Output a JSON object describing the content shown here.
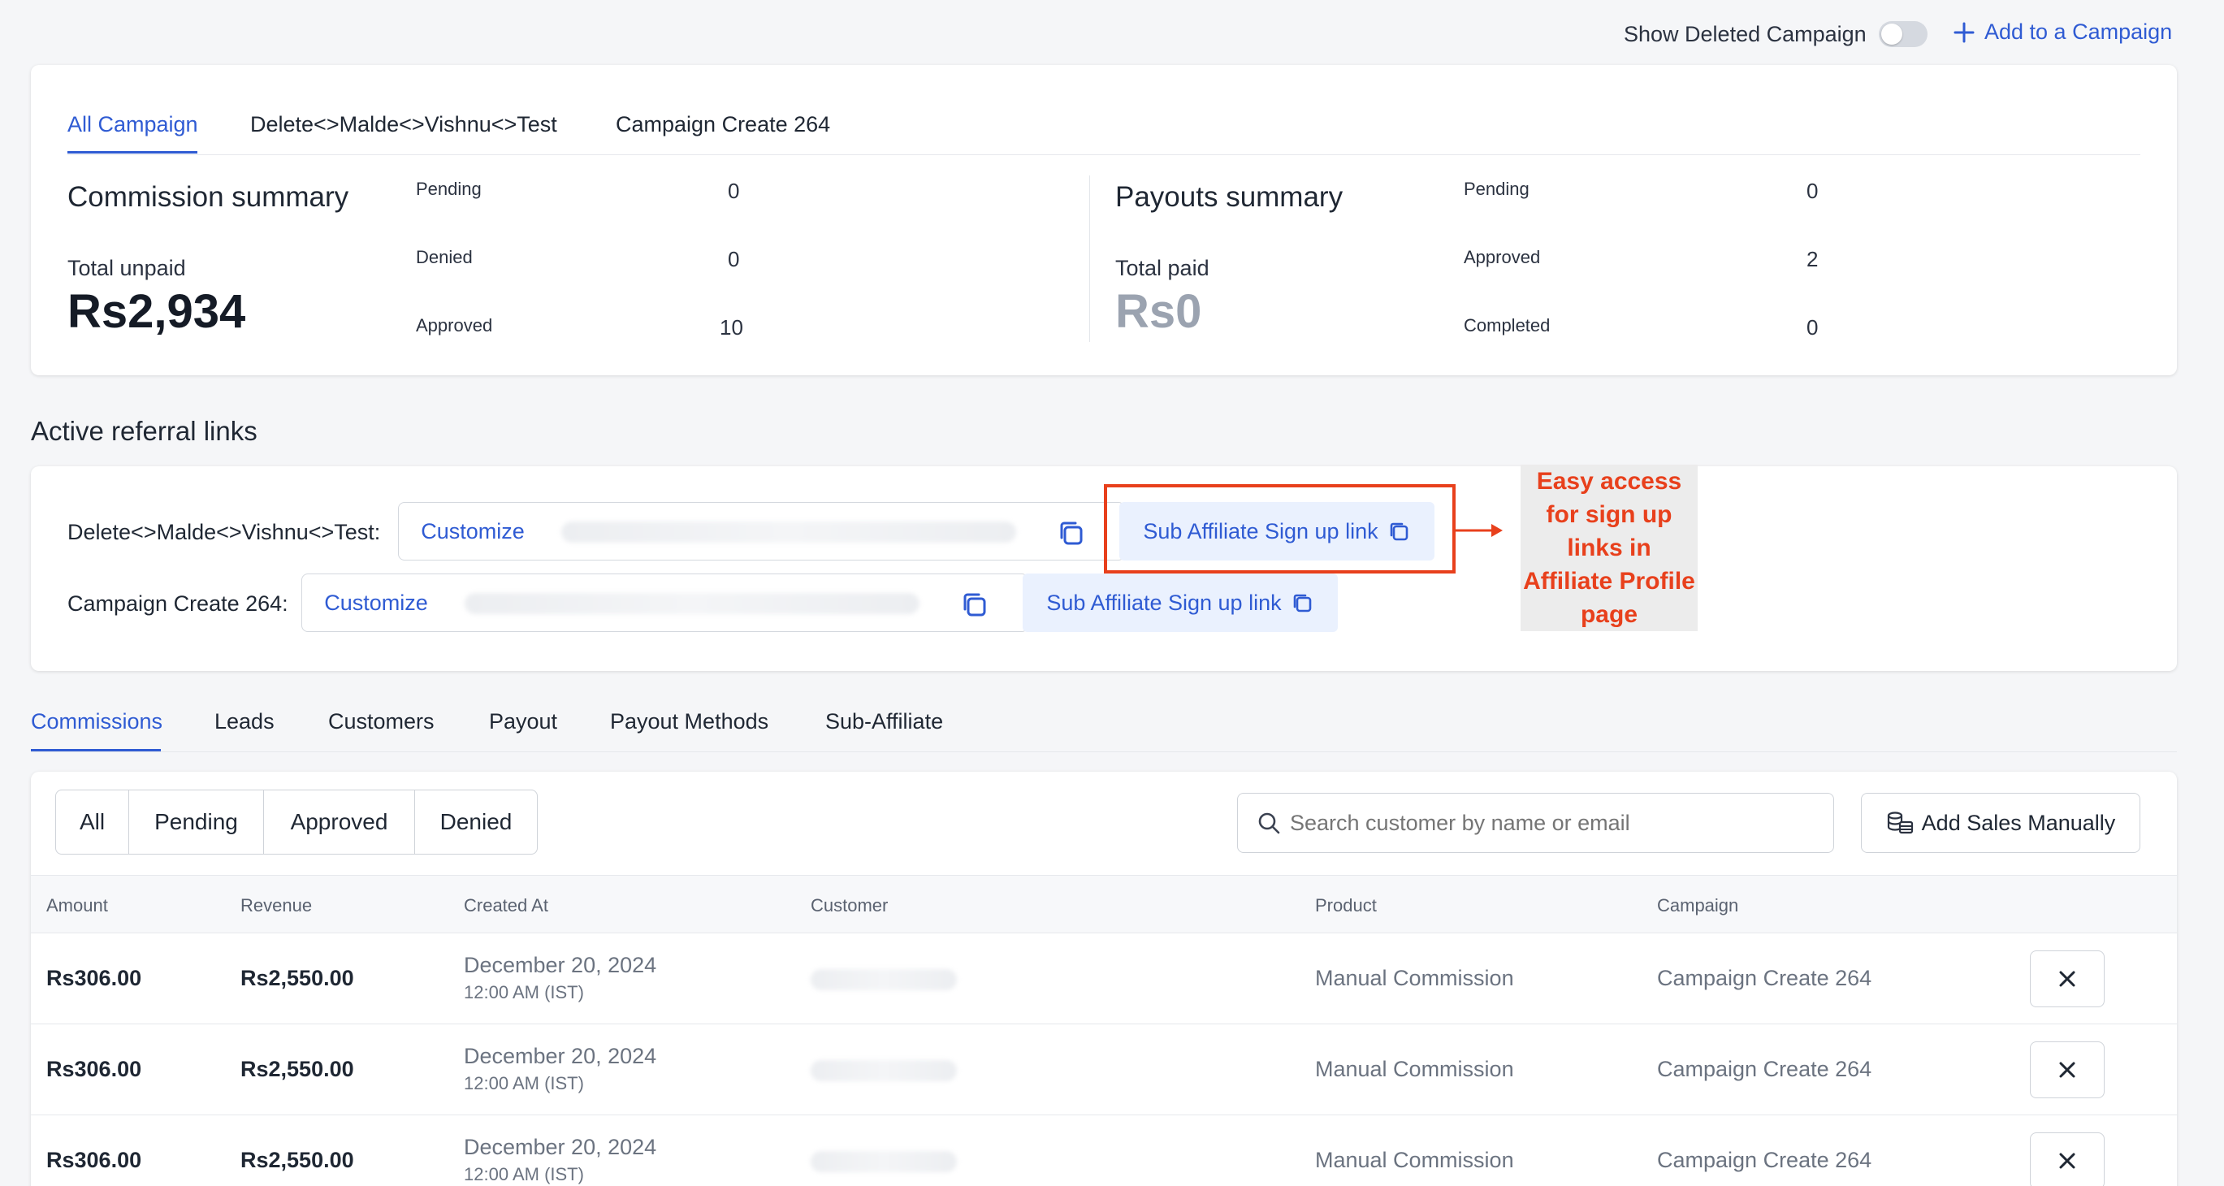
{
  "topbar": {
    "show_deleted_label": "Show Deleted Campaign",
    "add_campaign_label": "Add to a Campaign"
  },
  "campaign_tabs": [
    "All Campaign",
    "Delete<>Malde<>Vishnu<>Test",
    "Campaign Create 264"
  ],
  "commission_summary": {
    "title": "Commission summary",
    "total_label": "Total unpaid",
    "total_value": "Rs2,934",
    "rows": [
      {
        "label": "Pending",
        "value": "0"
      },
      {
        "label": "Denied",
        "value": "0"
      },
      {
        "label": "Approved",
        "value": "10"
      }
    ]
  },
  "payouts_summary": {
    "title": "Payouts summary",
    "total_label": "Total paid",
    "total_value": "Rs0",
    "rows": [
      {
        "label": "Pending",
        "value": "0"
      },
      {
        "label": "Approved",
        "value": "2"
      },
      {
        "label": "Completed",
        "value": "0"
      }
    ]
  },
  "referral": {
    "section_title": "Active referral links",
    "links": [
      {
        "campaign": "Delete<>Malde<>Vishnu<>Test:",
        "customize": "Customize",
        "sub_affiliate": "Sub Affiliate Sign up link"
      },
      {
        "campaign": "Campaign Create 264:",
        "customize": "Customize",
        "sub_affiliate": "Sub Affiliate Sign up link"
      }
    ],
    "annotation": "Easy access for sign up links in Affiliate Profile page"
  },
  "main_tabs": [
    "Commissions",
    "Leads",
    "Customers",
    "Payout",
    "Payout Methods",
    "Sub-Affiliate"
  ],
  "filters": [
    "All",
    "Pending",
    "Approved",
    "Denied"
  ],
  "search": {
    "placeholder": "Search customer by name or email"
  },
  "add_sales_label": "Add Sales Manually",
  "table": {
    "headers": [
      "Amount",
      "Revenue",
      "Created At",
      "Customer",
      "Product",
      "Campaign"
    ],
    "rows": [
      {
        "amount": "Rs306.00",
        "revenue": "Rs2,550.00",
        "date": "December 20, 2024",
        "time": "12:00 AM (IST)",
        "product": "Manual Commission",
        "campaign": "Campaign Create 264"
      },
      {
        "amount": "Rs306.00",
        "revenue": "Rs2,550.00",
        "date": "December 20, 2024",
        "time": "12:00 AM (IST)",
        "product": "Manual Commission",
        "campaign": "Campaign Create 264"
      },
      {
        "amount": "Rs306.00",
        "revenue": "Rs2,550.00",
        "date": "December 20, 2024",
        "time": "12:00 AM (IST)",
        "product": "Manual Commission",
        "campaign": "Campaign Create 264"
      }
    ]
  },
  "colors": {
    "accent": "#2f5bd3",
    "annotation": "#e8401c"
  }
}
